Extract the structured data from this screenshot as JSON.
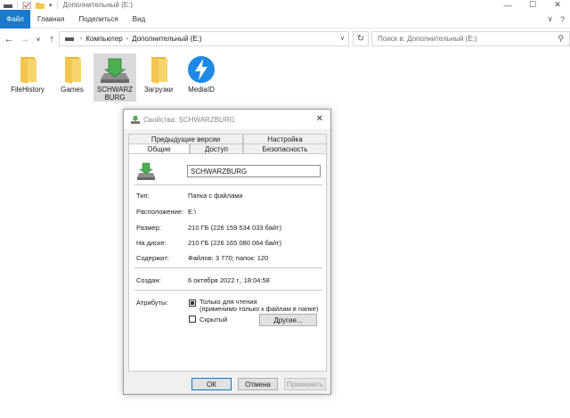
{
  "window": {
    "title": "Дополнительный (E:)",
    "controls": {
      "minimize": "—",
      "maximize": "☐",
      "close": "✕"
    }
  },
  "ribbon": {
    "tabs": [
      "Файл",
      "Главная",
      "Поделиться",
      "Вид"
    ],
    "right": {
      "collapse": "∨",
      "help": "?"
    }
  },
  "nav": {
    "back": "←",
    "forward": "→",
    "recent": "∨",
    "up": "↑",
    "breadcrumb": [
      "Компьютер",
      "Дополнительный (E:)"
    ],
    "refresh": "↻",
    "search_placeholder": "Поиск в: Дополнительный (E:)"
  },
  "files": [
    {
      "label": "FileHistory",
      "type": "folder"
    },
    {
      "label": "Games",
      "type": "folder"
    },
    {
      "label": "SCHWARZ\nBURG",
      "type": "special-folder",
      "selected": true
    },
    {
      "label": "Загрузки",
      "type": "folder"
    },
    {
      "label": "MediaID",
      "type": "app"
    }
  ],
  "dialog": {
    "title": "Свойства: SCHWARZBURG",
    "close": "✕",
    "tabs_top": [
      "Предыдущие версии",
      "Настройка"
    ],
    "tabs_bottom": [
      "Общие",
      "Доступ",
      "Безопасность"
    ],
    "active_tab": "Общие",
    "name_value": "SCHWARZBURG",
    "props": [
      {
        "label": "Тип:",
        "value": "Папка с файлами"
      },
      {
        "label": "Расположение:",
        "value": "E:\\"
      },
      {
        "label": "Размер:",
        "value": "210 ГБ (226 159 534 033 байт)"
      },
      {
        "label": "На диске:",
        "value": "210 ГБ (226 165 080 064 байт)"
      },
      {
        "label": "Содержит:",
        "value": "Файлов: 3 770; папок: 120"
      }
    ],
    "created": {
      "label": "Создан:",
      "value": "6 октября 2022 г., 18:04:58"
    },
    "attributes": {
      "label": "Атрибуты:",
      "readonly_line1": "Только для чтения",
      "readonly_line2": "(применимо только к файлам в папке)",
      "hidden": "Скрытый",
      "other_button": "Другие..."
    },
    "buttons": {
      "ok": "ОК",
      "cancel": "Отмена",
      "apply": "Применить"
    }
  },
  "colors": {
    "accent": "#1979ca",
    "folder": "#f3c650",
    "app_blue": "#1e88e5"
  }
}
